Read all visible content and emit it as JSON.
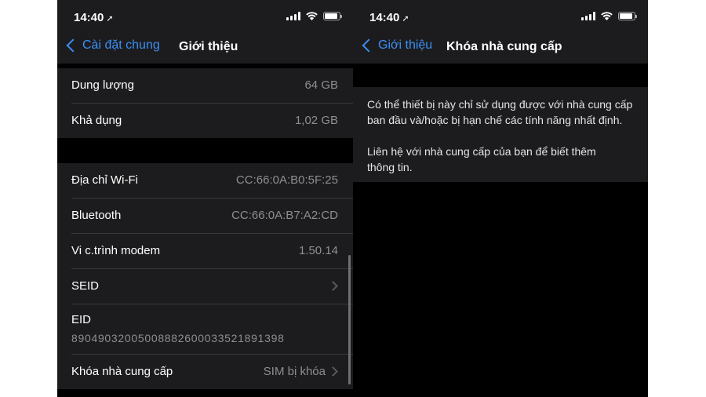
{
  "left": {
    "status": {
      "time": "14:40"
    },
    "nav": {
      "back_label": "Cài đặt chung",
      "title": "Giới thiệu"
    },
    "group1": [
      {
        "label": "Dung lượng",
        "value": "64 GB"
      },
      {
        "label": "Khả dụng",
        "value": "1,02 GB"
      }
    ],
    "group2": [
      {
        "label": "Địa chỉ Wi-Fi",
        "value": "CC:66:0A:B0:5F:25"
      },
      {
        "label": "Bluetooth",
        "value": "CC:66:0A:B7:A2:CD"
      },
      {
        "label": "Vi c.trình modem",
        "value": "1.50.14"
      },
      {
        "label": "SEID",
        "value": ""
      },
      {
        "label": "EID",
        "value": "89049032005008882600033521891398"
      },
      {
        "label": "Khóa nhà cung cấp",
        "value": "SIM bị khóa"
      }
    ]
  },
  "right": {
    "status": {
      "time": "14:40"
    },
    "nav": {
      "back_label": "Giới thiệu",
      "title": "Khóa nhà cung cấp"
    },
    "info": {
      "paragraph1_line1": "Có thể thiết bị này chỉ sử dụng được với nhà cung cấp",
      "paragraph1_line2": "ban đầu và/hoặc bị hạn chế các tính năng nhất định.",
      "paragraph2_line1": "Liên hệ với nhà cung cấp của bạn để biết thêm",
      "paragraph2_line2": "thông tin."
    }
  },
  "icons": {
    "location": "location-arrow-icon",
    "signal": "cellular-signal-icon",
    "wifi": "wifi-icon",
    "battery": "battery-icon",
    "back": "chevron-left-icon",
    "disclosure": "chevron-right-icon"
  },
  "colors": {
    "accent": "#3b8ff5",
    "background": "#000000",
    "cell": "#1c1c1e",
    "secondary_text": "#8e8e93"
  }
}
